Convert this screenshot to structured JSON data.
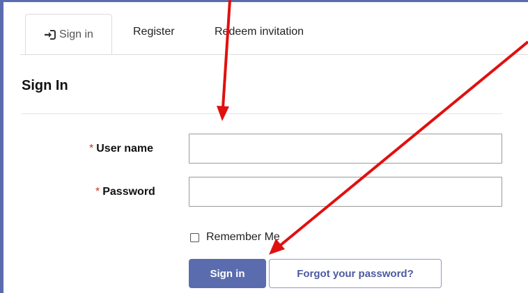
{
  "tabs": {
    "signin_label": "Sign in",
    "register_label": "Register",
    "redeem_label": "Redeem invitation"
  },
  "page": {
    "heading": "Sign In"
  },
  "form": {
    "required_mark": "*",
    "username_label": "User name",
    "username_value": "",
    "password_label": "Password",
    "password_value": "",
    "remember_label": "Remember Me",
    "remember_checked": false
  },
  "buttons": {
    "signin_label": "Sign in",
    "forgot_label": "Forgot your password?"
  },
  "colors": {
    "accent": "#5b6cae",
    "annotation_arrow": "#e01010",
    "required": "#c0392b"
  },
  "icons": {
    "signin_tab_icon": "sign-in-icon"
  }
}
